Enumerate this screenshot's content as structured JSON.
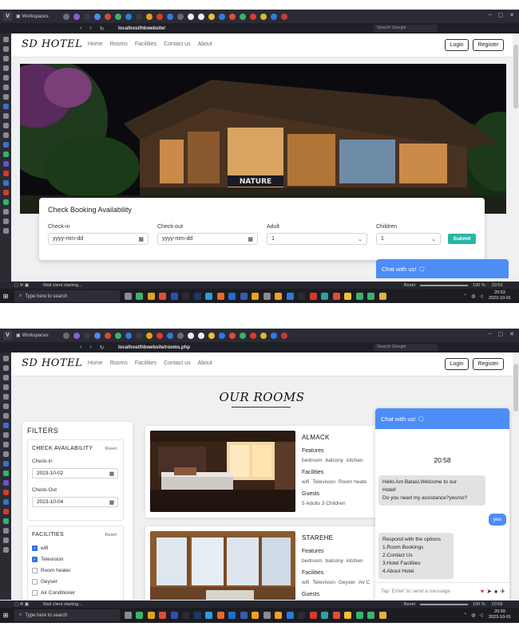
{
  "browser": {
    "workspaces_label": "Workspaces",
    "url_home": "localhost/hbwebsite/",
    "url_rooms": "localhost/hbwebsite/rooms.php",
    "search_placeholder": "Search Google"
  },
  "site": {
    "brand": "SD HOTEL",
    "nav": [
      "Home",
      "Rooms",
      "Facilities",
      "Contact us",
      "About"
    ],
    "login_label": "Login",
    "register_label": "Register"
  },
  "booking": {
    "title": "Check Booking Availability",
    "checkin_label": "Check-in",
    "checkin_placeholder": "yyyy-mm-dd",
    "checkout_label": "Check-out",
    "checkout_placeholder": "yyyy-mm-dd",
    "adult_label": "Adult",
    "adult_value": "1",
    "children_label": "Children",
    "children_value": "1",
    "submit_label": "Submit"
  },
  "hero": {
    "sign_text": "NATURE"
  },
  "chat": {
    "header": "Chat with us! 🗨",
    "time": "20:58",
    "bot_welcome": [
      "Hello Am Batasi,Welcome to our",
      "Hotel!",
      "Do you need my assistance?yes/no?"
    ],
    "user_reply": "yes",
    "bot_options": [
      "Respond with the options",
      "1.Room Bookings",
      "2.Contact Us",
      "3.Hotel Facilities",
      "4.About Hotel"
    ],
    "input_placeholder": "Tap 'Enter' to send a message"
  },
  "rooms_page": {
    "title": "OUR ROOMS",
    "filters": {
      "title": "FILTERS",
      "availability": {
        "heading": "CHECK AVAILABILITY",
        "reset": "Reset",
        "checkin_label": "Check-in",
        "checkin_value": "2023-10-02",
        "checkout_label": "Check-Out",
        "checkout_value": "2023-10-04"
      },
      "facilities": {
        "heading": "FACILITIES",
        "reset": "Reset",
        "items": [
          {
            "label": "wifi",
            "checked": true
          },
          {
            "label": "Television",
            "checked": true
          },
          {
            "label": "Room heater",
            "checked": false
          },
          {
            "label": "Geyser",
            "checked": false
          },
          {
            "label": "Air Conditioner",
            "checked": false
          }
        ]
      }
    },
    "rooms": [
      {
        "name": "ALMACK",
        "features_label": "Features",
        "features": [
          "bedroom",
          "balcony",
          "kitchen"
        ],
        "facilities_label": "Facilities",
        "facilities": [
          "wifi",
          "Television",
          "Room heate"
        ],
        "guests_label": "Guests",
        "guests": "5 Adults 3 Children"
      },
      {
        "name": "STAREHE",
        "features_label": "Features",
        "features": [
          "bedroom",
          "balcony",
          "kitchen"
        ],
        "facilities_label": "Facilities",
        "facilities": [
          "wifi",
          "Television",
          "Geyser",
          "Air C"
        ],
        "guests_label": "Guests"
      }
    ]
  },
  "status": {
    "mail_status": "Mail client starting...",
    "reset_label": "Reset",
    "zoom": "100 %",
    "time_top": "20:53",
    "time_bottom": "20:59"
  },
  "taskbar": {
    "search_placeholder": "Type here to search",
    "clock1_time": "20:53",
    "clock1_date": "2023-10-01",
    "clock2_time": "20:59",
    "clock2_date": "2023-10-01"
  }
}
